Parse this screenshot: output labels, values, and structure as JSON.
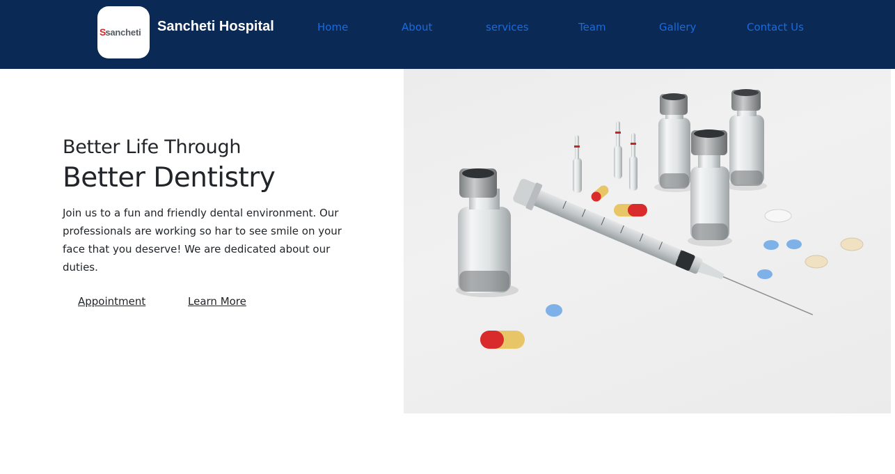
{
  "brand": {
    "logo_s": "S",
    "logo_word": "sancheti",
    "name": "Sancheti Hospital"
  },
  "nav": {
    "items": [
      {
        "label": "Home"
      },
      {
        "label": "About"
      },
      {
        "label": "services"
      },
      {
        "label": "Team"
      },
      {
        "label": "Gallery"
      },
      {
        "label": "Contact Us"
      }
    ]
  },
  "hero": {
    "subtitle": "Better Life Through",
    "title": "Better Dentistry",
    "description": "Join us to a fun and friendly dental environment. Our professionals are working so har to see smile on your face that you deserve! We are dedicated about our duties.",
    "appointment_label": "Appointment",
    "learn_more_label": "Learn More"
  },
  "colors": {
    "navbar_bg": "#0b2955",
    "nav_link": "#1a6bdc",
    "brand_text": "#ffffff"
  },
  "image": {
    "icon": "syringe-vials-pills-photo"
  }
}
